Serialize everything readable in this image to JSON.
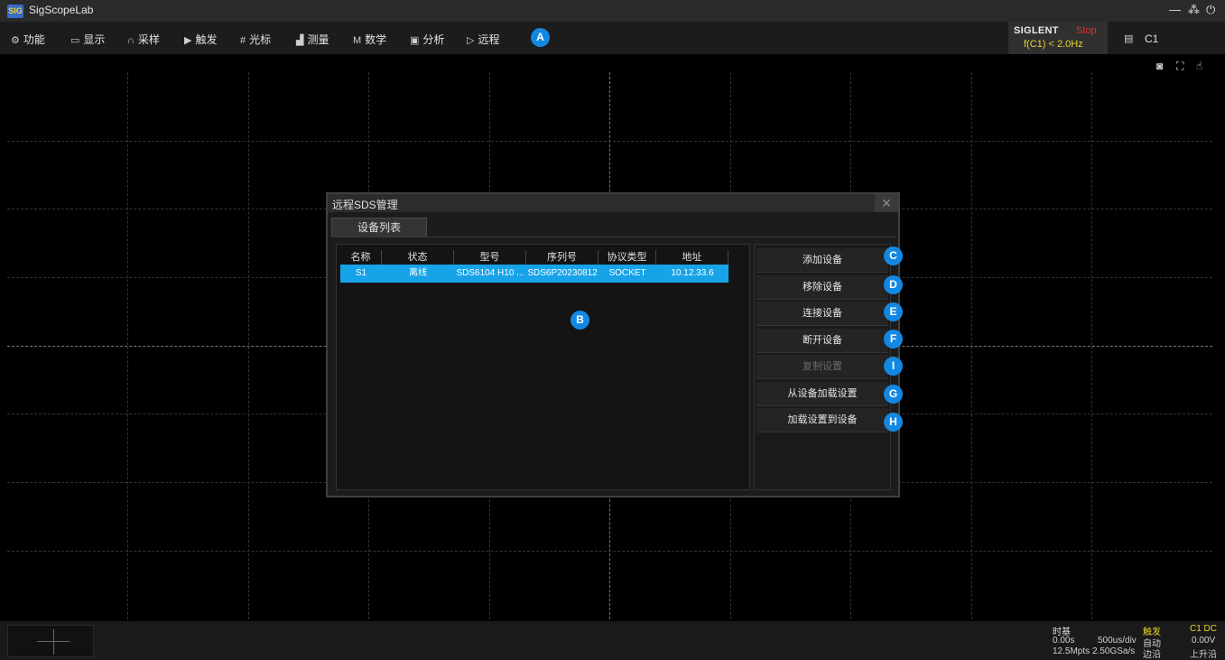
{
  "app": {
    "title": "SigScopeLab",
    "logo_text": "SIG"
  },
  "window_controls": {
    "minimize": "—",
    "restore": "⁂",
    "power": "⏻"
  },
  "menu": [
    {
      "label": "功能",
      "icon": "⚙",
      "icon_name": "gear-icon"
    },
    {
      "label": "显示",
      "icon": "▭",
      "icon_name": "display-icon"
    },
    {
      "label": "采样",
      "icon": "∩",
      "icon_name": "sample-icon"
    },
    {
      "label": "触发",
      "icon": "▶",
      "icon_name": "trigger-icon"
    },
    {
      "label": "光标",
      "icon": "#",
      "icon_name": "cursor-icon"
    },
    {
      "label": "测量",
      "icon": "▟",
      "icon_name": "measure-icon"
    },
    {
      "label": "数学",
      "icon": "M",
      "icon_name": "math-icon"
    },
    {
      "label": "分析",
      "icon": "▣",
      "icon_name": "analysis-icon"
    },
    {
      "label": "远程",
      "icon": "▷",
      "icon_name": "remote-icon"
    }
  ],
  "badges": [
    "A",
    "B",
    "C",
    "D",
    "E",
    "F",
    "I",
    "G",
    "H"
  ],
  "status": {
    "brand": "SIGLENT",
    "run_state": "Stop",
    "frequency": "f(C1) < 2.0Hz",
    "channel": "C1"
  },
  "toolbar_icons": {
    "screenshot": "◙",
    "fullscreen": "⛶",
    "touch": "☝"
  },
  "dialog": {
    "title": "远程SDS管理",
    "close": "✕",
    "tab": "设备列表",
    "columns": [
      "名称",
      "状态",
      "型号",
      "序列号",
      "协议类型",
      "地址"
    ],
    "rows": [
      {
        "name": "S1",
        "status": "离线",
        "model": "SDS6104 H10 ...",
        "serial": "SDS6P20230812",
        "protocol": "SOCKET",
        "address": "10.12.33.6"
      }
    ],
    "actions": [
      {
        "label": "添加设备",
        "enabled": true
      },
      {
        "label": "移除设备",
        "enabled": true
      },
      {
        "label": "连接设备",
        "enabled": true
      },
      {
        "label": "断开设备",
        "enabled": true
      },
      {
        "label": "复制设置",
        "enabled": false
      },
      {
        "label": "从设备加载设置",
        "enabled": true
      },
      {
        "label": "加载设置到设备",
        "enabled": true
      }
    ]
  },
  "bottom": {
    "timebase": {
      "title": "时基",
      "delay": "0.00s",
      "scale": "500us/div",
      "points": "12.5Mpts",
      "rate": "2.50GSa/s"
    },
    "trigger": {
      "title": "触发",
      "mode": "自动",
      "type": "边沿"
    },
    "channel": {
      "title": "C1 DC",
      "level": "0.00V",
      "slope": "上升沿"
    }
  },
  "colors": {
    "accent": "#1388e3",
    "row_highlight": "#17a3e8",
    "stop": "#e03030",
    "freq": "#e7d22a",
    "trigger": "#e7d22a"
  }
}
